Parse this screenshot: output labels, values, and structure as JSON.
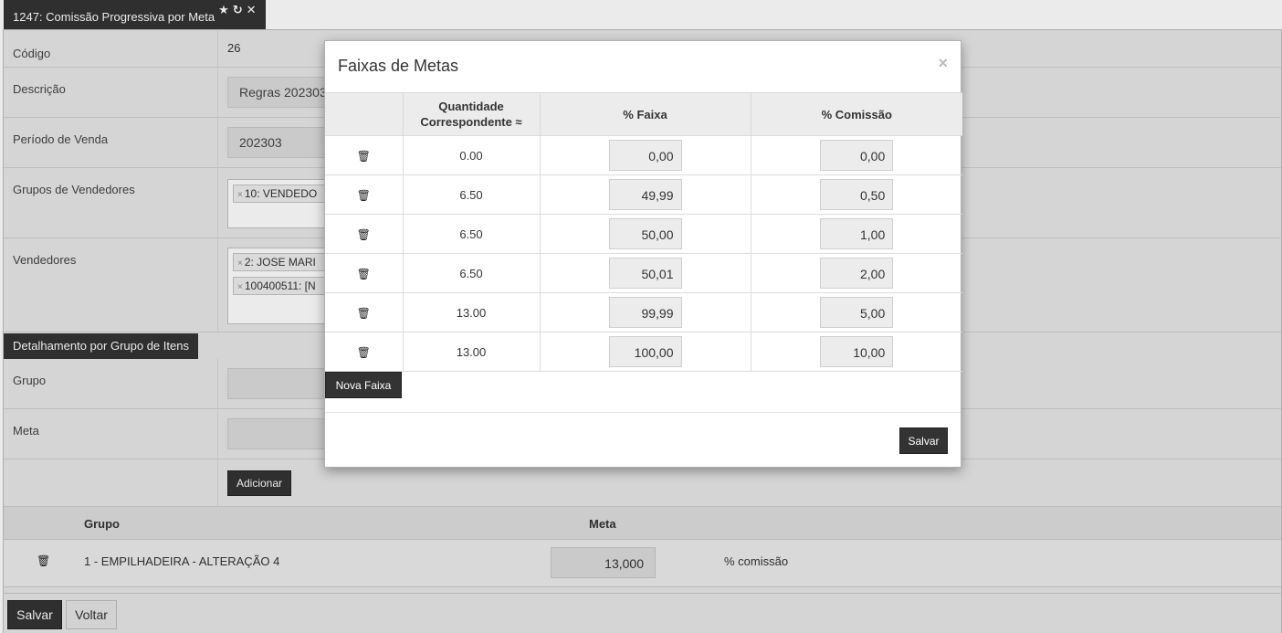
{
  "window": {
    "title": "1247: Comissão Progressiva por Meta"
  },
  "form": {
    "codigo": {
      "label": "Código",
      "value": "26"
    },
    "descricao": {
      "label": "Descrição",
      "value": "Regras 202303"
    },
    "periodo": {
      "label": "Período de Venda",
      "value": "202303"
    },
    "grupos_vendedores": {
      "label": "Grupos de Vendedores",
      "tags": [
        "10: VENDEDO"
      ]
    },
    "vendedores": {
      "label": "Vendedores",
      "tags": [
        "2: JOSE MARI",
        "100400511: [N"
      ]
    },
    "section_title": "Detalhamento por Grupo de Itens",
    "grupo": {
      "label": "Grupo"
    },
    "meta": {
      "label": "Meta"
    },
    "adicionar_label": "Adicionar",
    "grid": {
      "columns": [
        "Grupo",
        "Meta"
      ],
      "rows": [
        {
          "grupo": "1 - EMPILHADEIRA - ALTERAÇÃO 4",
          "meta": "13,000",
          "extra": "% comissão"
        }
      ]
    },
    "footer": {
      "salvar": "Salvar",
      "voltar": "Voltar"
    }
  },
  "modal": {
    "title": "Faixas de Metas",
    "close": "×",
    "columns": {
      "quantidade_line1": "Quantidade",
      "quantidade_line2": "Correspondente ≈",
      "faixa": "% Faixa",
      "comissao": "% Comissão"
    },
    "rows": [
      {
        "quantidade": "0.00",
        "faixa": "0,00",
        "comissao": "0,00"
      },
      {
        "quantidade": "6.50",
        "faixa": "49,99",
        "comissao": "0,50"
      },
      {
        "quantidade": "6.50",
        "faixa": "50,00",
        "comissao": "1,00"
      },
      {
        "quantidade": "6.50",
        "faixa": "50,01",
        "comissao": "2,00"
      },
      {
        "quantidade": "13.00",
        "faixa": "99,99",
        "comissao": "5,00"
      },
      {
        "quantidade": "13.00",
        "faixa": "100,00",
        "comissao": "10,00"
      }
    ],
    "nova_faixa": "Nova Faixa",
    "salvar": "Salvar"
  },
  "icons": {
    "star": "star-icon",
    "refresh": "refresh-icon",
    "close": "close-icon",
    "trash": "trash-icon"
  }
}
